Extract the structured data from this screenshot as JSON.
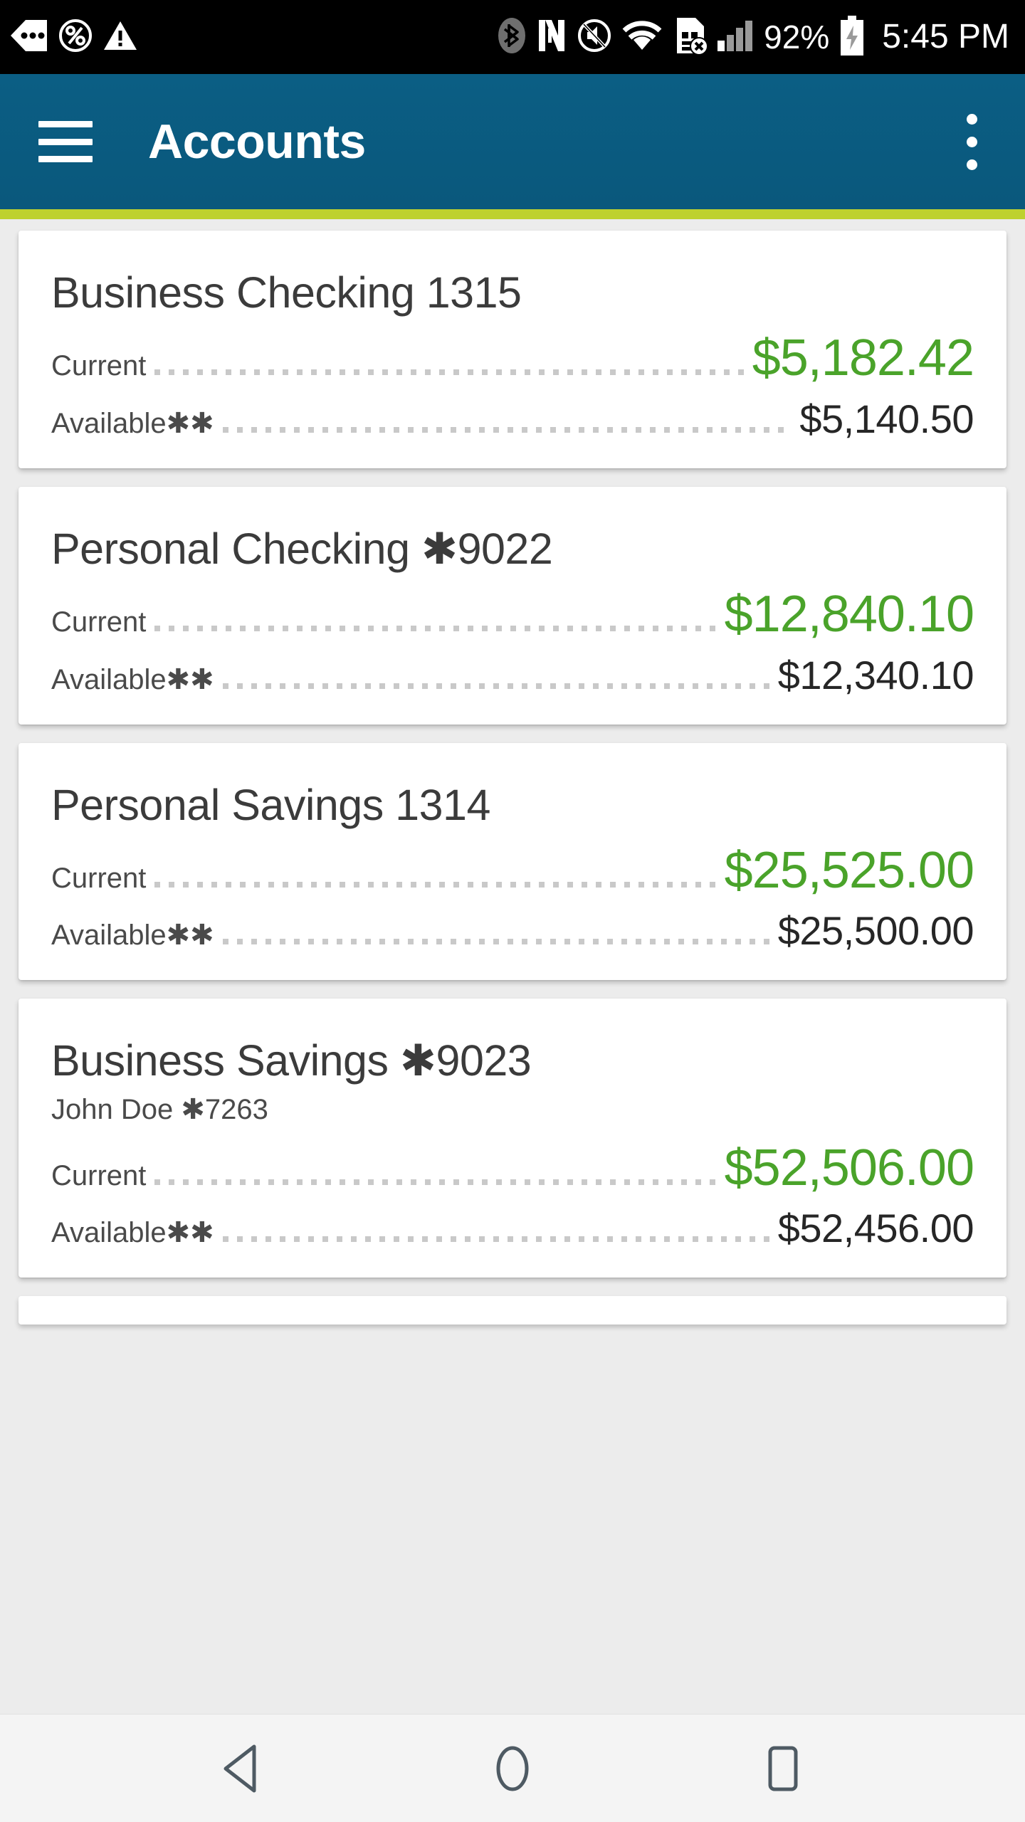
{
  "status_bar": {
    "icons_left": [
      "back-arrow-dots-icon",
      "percent-circle-icon",
      "warning-triangle-icon"
    ],
    "icons_right": [
      "bluetooth-icon",
      "nfc-icon",
      "mute-icon",
      "wifi-icon",
      "sim-card-error-icon",
      "signal-bars-icon"
    ],
    "battery_percent": "92%",
    "battery_icon": "battery-charging-icon",
    "time": "5:45 PM"
  },
  "app_bar": {
    "menu_icon": "hamburger-menu-icon",
    "title": "Accounts",
    "overflow_icon": "overflow-menu-icon",
    "background_color": "#0b5e84",
    "accent_color": "#bed12e"
  },
  "labels": {
    "current": "Current",
    "available": "Available✱✱"
  },
  "colors": {
    "current_value": "#4aa32a",
    "available_value": "#262626",
    "card_background": "#ffffff",
    "page_background": "#ececec"
  },
  "accounts": [
    {
      "title": "Business Checking 1315",
      "subtitle": "",
      "current": "$5,182.42",
      "available": "$5,140.50"
    },
    {
      "title": "Personal Checking ✱9022",
      "subtitle": "",
      "current": "$12,840.10",
      "available": "$12,340.10"
    },
    {
      "title": "Personal Savings 1314",
      "subtitle": "",
      "current": "$25,525.00",
      "available": "$25,500.00"
    },
    {
      "title": "Business Savings ✱9023",
      "subtitle": "John Doe ✱7263",
      "current": "$52,506.00",
      "available": "$52,456.00"
    }
  ],
  "nav_bar": {
    "back_icon": "back-triangle-icon",
    "home_icon": "home-circle-icon",
    "recents_icon": "recents-square-icon"
  }
}
